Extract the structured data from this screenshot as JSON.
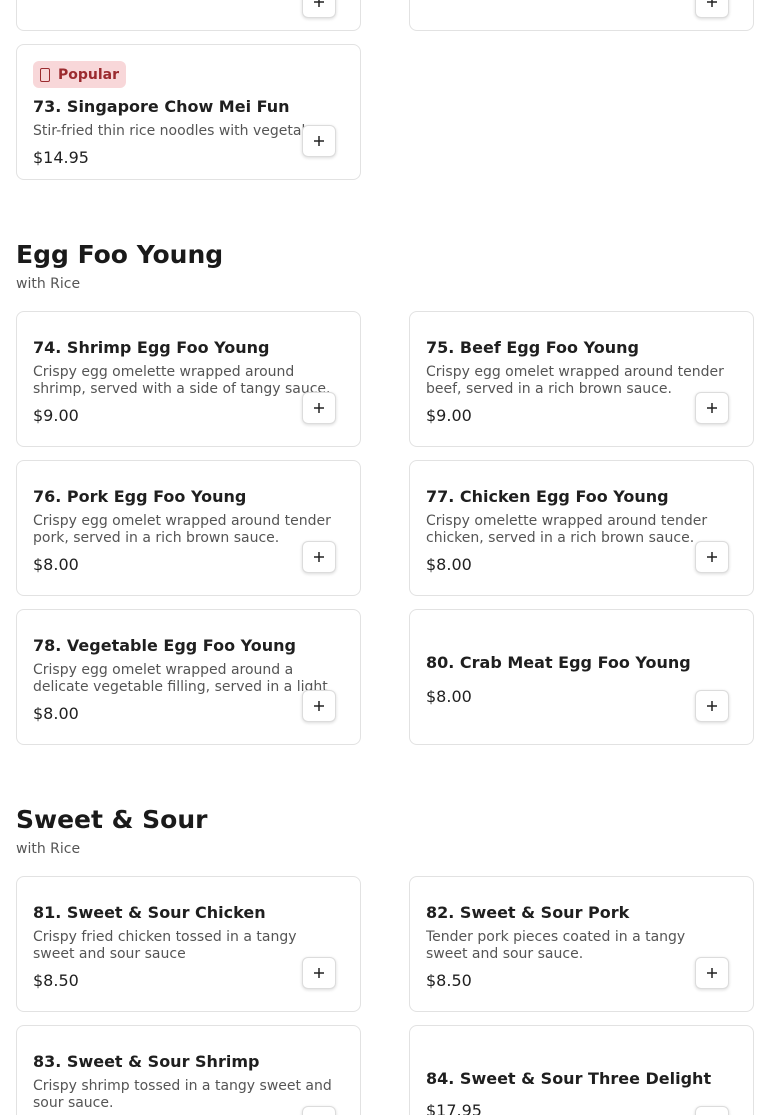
{
  "top_partial": {
    "left": {
      "add_label": "+"
    },
    "right": {
      "add_label": "+"
    }
  },
  "item73": {
    "badge": "Popular",
    "name": "73. Singapore Chow Mei Fun",
    "desc": "Stir-fried thin rice noodles with vegetables",
    "price": "$14.95"
  },
  "sections": [
    {
      "title": "Egg Foo Young",
      "subtitle": "with Rice",
      "items": [
        {
          "name": "74. Shrimp Egg Foo Young",
          "desc": "Crispy egg omelette wrapped around shrimp, served with a side of tangy sauce.",
          "price": "$9.00"
        },
        {
          "name": "75. Beef Egg Foo Young",
          "desc": "Crispy egg omelet wrapped around tender beef, served in a rich brown sauce.",
          "price": "$9.00"
        },
        {
          "name": "76. Pork Egg Foo Young",
          "desc": "Crispy egg omelet wrapped around tender pork, served in a rich brown sauce.",
          "price": "$8.00"
        },
        {
          "name": "77. Chicken Egg Foo Young",
          "desc": "Crispy omelette wrapped around tender chicken, served in a rich brown sauce.",
          "price": "$8.00"
        },
        {
          "name": "78. Vegetable Egg Foo Young",
          "desc": "Crispy egg omelet wrapped around a delicate vegetable filling, served in a light ...",
          "price": "$8.00"
        },
        {
          "name": "80. Crab Meat Egg Foo Young",
          "desc": "",
          "price": "$8.00"
        }
      ]
    },
    {
      "title": "Sweet & Sour",
      "subtitle": "with Rice",
      "items": [
        {
          "name": "81. Sweet & Sour Chicken",
          "desc": "Crispy fried chicken tossed in a tangy sweet and sour sauce",
          "price": "$8.50"
        },
        {
          "name": "82. Sweet & Sour Pork",
          "desc": "Tender pork pieces coated in a tangy sweet and sour sauce.",
          "price": "$8.50"
        },
        {
          "name": "83. Sweet & Sour Shrimp",
          "desc": "Crispy shrimp tossed in a tangy sweet and sour sauce.",
          "price": ""
        },
        {
          "name": "84. Sweet & Sour Three Delight",
          "desc": "",
          "price": "$17.95"
        }
      ]
    }
  ]
}
